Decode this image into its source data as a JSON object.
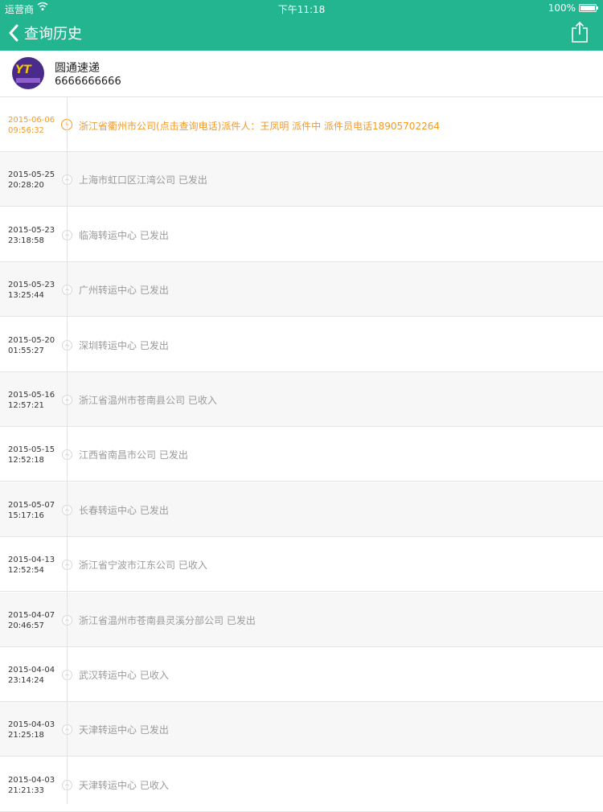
{
  "status_bar": {
    "carrier": "运营商",
    "time": "下午11:18",
    "battery": "100%"
  },
  "nav": {
    "title": "查询历史",
    "back_icon": "chevron-left-icon",
    "share_icon": "share-icon"
  },
  "company": {
    "name": "圆通速递",
    "tracking_number": "6666666666"
  },
  "accent_color": "#22b58f",
  "current_color": "#f59a23",
  "records": [
    {
      "date": "2015-06-06",
      "time": "09:56:32",
      "desc": "浙江省衢州市公司(点击查询电话)派件人：王凤明 派件中 派件员电话18905702264",
      "current": true
    },
    {
      "date": "2015-05-25",
      "time": "20:28:20",
      "desc": "上海市虹口区江湾公司 已发出"
    },
    {
      "date": "2015-05-23",
      "time": "23:18:58",
      "desc": "临海转运中心 已发出"
    },
    {
      "date": "2015-05-23",
      "time": "13:25:44",
      "desc": "广州转运中心 已发出"
    },
    {
      "date": "2015-05-20",
      "time": "01:55:27",
      "desc": "深圳转运中心 已发出"
    },
    {
      "date": "2015-05-16",
      "time": "12:57:21",
      "desc": "浙江省温州市苍南县公司 已收入"
    },
    {
      "date": "2015-05-15",
      "time": "12:52:18",
      "desc": "江西省南昌市公司 已发出"
    },
    {
      "date": "2015-05-07",
      "time": "15:17:16",
      "desc": "长春转运中心 已发出"
    },
    {
      "date": "2015-04-13",
      "time": "12:52:54",
      "desc": "浙江省宁波市江东公司 已收入"
    },
    {
      "date": "2015-04-07",
      "time": "20:46:57",
      "desc": "浙江省温州市苍南县灵溪分部公司 已发出"
    },
    {
      "date": "2015-04-04",
      "time": "23:14:24",
      "desc": "武汉转运中心 已收入"
    },
    {
      "date": "2015-04-03",
      "time": "21:25:18",
      "desc": "天津转运中心 已发出"
    },
    {
      "date": "2015-04-03",
      "time": "21:21:33",
      "desc": "天津转运中心 已收入"
    }
  ]
}
